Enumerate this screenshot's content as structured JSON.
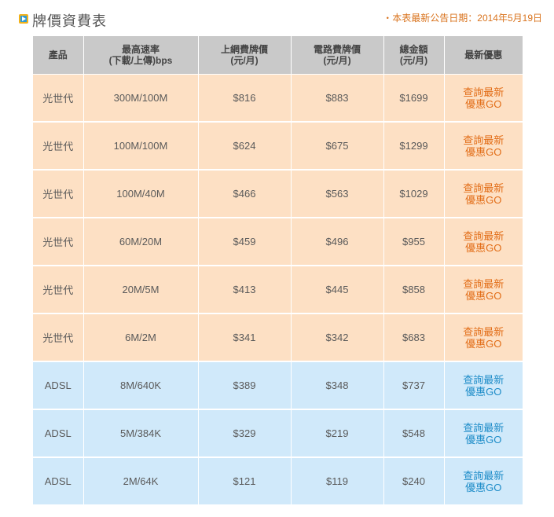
{
  "header": {
    "title": "牌價資費表",
    "notice": "・本表最新公告日期：2014年5月19日"
  },
  "table": {
    "columns": [
      {
        "line1": "產品",
        "line2": ""
      },
      {
        "line1": "最高速率",
        "line2": "(下載/上傳)bps"
      },
      {
        "line1": "上網費牌價",
        "line2": "(元/月)"
      },
      {
        "line1": "電路費牌價",
        "line2": "(元/月)"
      },
      {
        "line1": "總金額",
        "line2": "(元/月)"
      },
      {
        "line1": "最新優惠",
        "line2": ""
      }
    ],
    "rows": [
      {
        "group": "fiber",
        "product": "光世代",
        "speed": "300M/100M",
        "internet": "$816",
        "circuit": "$883",
        "total": "$1699",
        "promo1": "查詢最新",
        "promo2": "優惠GO"
      },
      {
        "group": "fiber",
        "product": "光世代",
        "speed": "100M/100M",
        "internet": "$624",
        "circuit": "$675",
        "total": "$1299",
        "promo1": "查詢最新",
        "promo2": "優惠GO"
      },
      {
        "group": "fiber",
        "product": "光世代",
        "speed": "100M/40M",
        "internet": "$466",
        "circuit": "$563",
        "total": "$1029",
        "promo1": "查詢最新",
        "promo2": "優惠GO"
      },
      {
        "group": "fiber",
        "product": "光世代",
        "speed": "60M/20M",
        "internet": "$459",
        "circuit": "$496",
        "total": "$955",
        "promo1": "查詢最新",
        "promo2": "優惠GO"
      },
      {
        "group": "fiber",
        "product": "光世代",
        "speed": "20M/5M",
        "internet": "$413",
        "circuit": "$445",
        "total": "$858",
        "promo1": "查詢最新",
        "promo2": "優惠GO"
      },
      {
        "group": "fiber",
        "product": "光世代",
        "speed": "6M/2M",
        "internet": "$341",
        "circuit": "$342",
        "total": "$683",
        "promo1": "查詢最新",
        "promo2": "優惠GO"
      },
      {
        "group": "adsl",
        "product": "ADSL",
        "speed": "8M/640K",
        "internet": "$389",
        "circuit": "$348",
        "total": "$737",
        "promo1": "查詢最新",
        "promo2": "優惠GO"
      },
      {
        "group": "adsl",
        "product": "ADSL",
        "speed": "5M/384K",
        "internet": "$329",
        "circuit": "$219",
        "total": "$548",
        "promo1": "查詢最新",
        "promo2": "優惠GO"
      },
      {
        "group": "adsl",
        "product": "ADSL",
        "speed": "2M/64K",
        "internet": "$121",
        "circuit": "$119",
        "total": "$240",
        "promo1": "查詢最新",
        "promo2": "優惠GO"
      }
    ]
  },
  "colors": {
    "fiber_row": "#fde0c4",
    "adsl_row": "#d0e9fa",
    "header_row": "#c9c9c9",
    "fiber_promo": "#e26d17",
    "adsl_promo": "#1d8cc8",
    "notice": "#d9731d"
  },
  "icons": {
    "title_icon": "play-square-icon"
  }
}
